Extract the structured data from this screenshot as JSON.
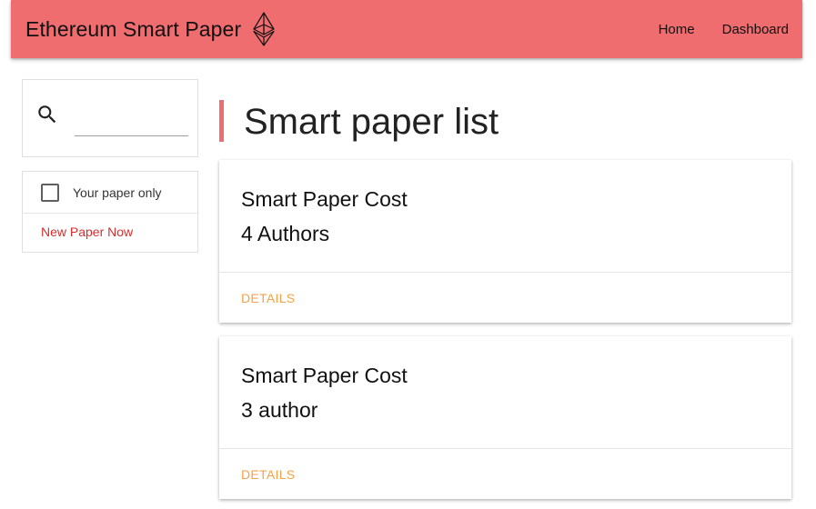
{
  "header": {
    "title": "Ethereum Smart Paper",
    "logo_icon": "ethereum-icon",
    "nav": [
      {
        "label": "Home"
      },
      {
        "label": "Dashboard"
      }
    ],
    "color": "#ef6c6f"
  },
  "sidebar": {
    "search": {
      "icon": "search-icon",
      "value": "",
      "placeholder": ""
    },
    "filter": {
      "checkbox_label": "Your paper only",
      "checked": false,
      "new_paper_label": "New Paper Now",
      "new_paper_color": "#d32f2f"
    }
  },
  "main": {
    "title": "Smart paper list",
    "papers": [
      {
        "title": "Smart Paper Cost",
        "authors": "4 Authors",
        "action": "DETAILS"
      },
      {
        "title": "Smart Paper Cost",
        "authors": "3 author",
        "action": "DETAILS"
      }
    ],
    "action_color": "#f7a14b"
  }
}
